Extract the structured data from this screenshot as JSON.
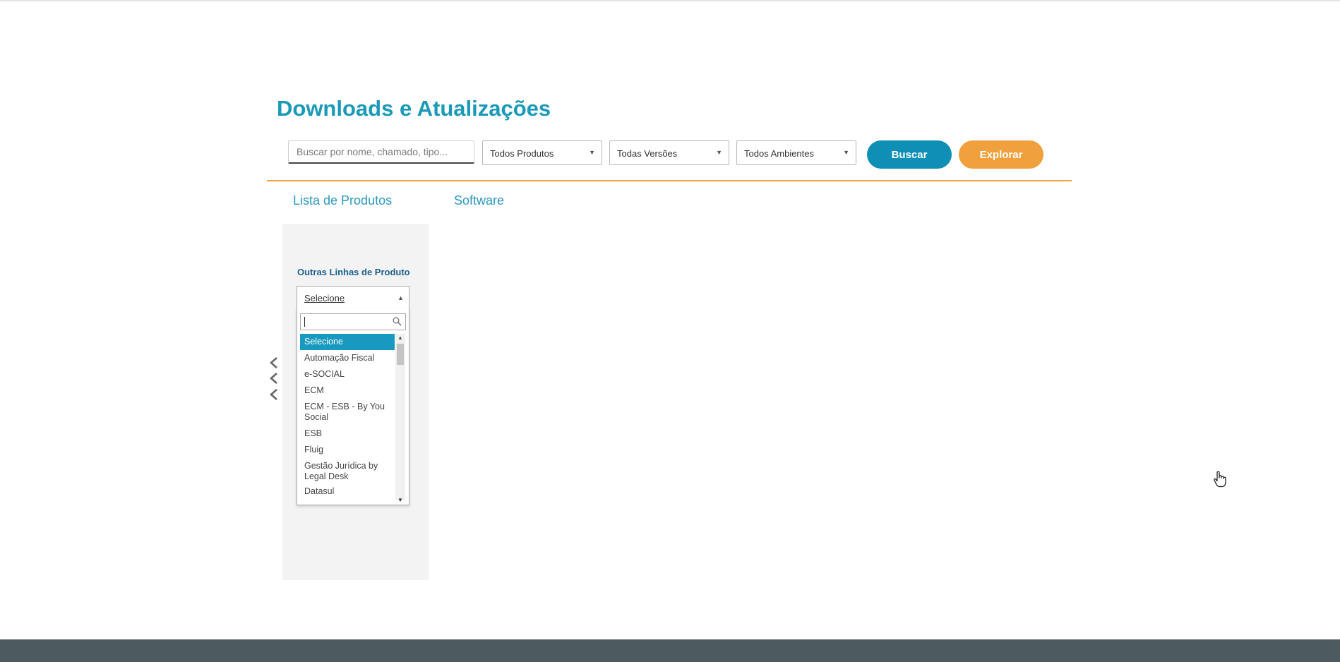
{
  "page": {
    "title": "Downloads e Atualizações"
  },
  "search": {
    "placeholder": "Buscar por nome, chamado, tipo..."
  },
  "filters": {
    "produtos": "Todos Produtos",
    "versoes": "Todas Versões",
    "ambientes": "Todos Ambientes"
  },
  "buttons": {
    "buscar": "Buscar",
    "explorar": "Explorar"
  },
  "tabs": {
    "lista": "Lista de Produtos",
    "software": "Software"
  },
  "sidebar": {
    "title": "Outras Linhas de Produto",
    "dropdown": {
      "selected": "Selecione",
      "options": [
        "Selecione",
        "Automação Fiscal",
        "e-SOCIAL",
        "ECM",
        "ECM - ESB - By You Social",
        "ESB",
        "Fluig",
        "Gestão Jurídica by Legal Desk",
        "Datasul"
      ]
    }
  },
  "colors": {
    "title": "#1a99b8",
    "buscar": "#0d8fb6",
    "explorar": "#f0a03c",
    "divider": "#f0a03c",
    "selected_option": "#1899bf",
    "footer": "#4d5a5f"
  },
  "icons": {
    "chevrons": "chevron-left-icon",
    "dropdown_search": "search-icon",
    "cursor": "hand-pointer-icon"
  }
}
